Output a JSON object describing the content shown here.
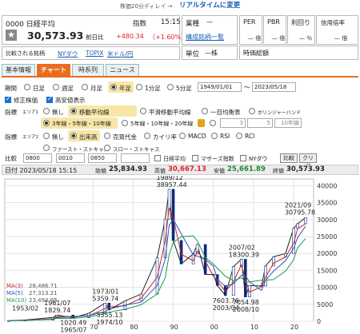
{
  "banner": {
    "notice": "株価20分ディレイ →",
    "realtime": "リアルタイムに変更"
  },
  "quote": {
    "code_name": "0000 日経平均",
    "price": "30,573.93",
    "prev_label": "前日比",
    "change": "+480.34",
    "change_pct": "（+1.60%）",
    "index_label": "指数",
    "time": "15:15"
  },
  "quote2": {
    "industry_label": "業種",
    "industry_value": "—",
    "components_link": "構成銘柄一覧",
    "unit_label": "単位",
    "unit_value": "—株"
  },
  "compare_bar": {
    "label": "比較される銘柄",
    "links": [
      "NYダウ",
      "TOPIX",
      "米ドル/円"
    ]
  },
  "metrics": {
    "headers": [
      "PER",
      "PBR",
      "利回り",
      "信用倍率"
    ],
    "values": [
      "— 倍",
      "— 倍",
      "— ％",
      "— 倍"
    ],
    "market_cap_label": "時価総額"
  },
  "tabs": [
    "基本情報",
    "チャート",
    "時系列",
    "ニュース"
  ],
  "period": {
    "label": "期間",
    "options": [
      "日足",
      "週足",
      "月足",
      "年足",
      "1分足",
      "5分足"
    ],
    "selected": 3,
    "from": "1949/01/01",
    "to": "2023/05/18"
  },
  "flags": {
    "adjusted": "修正株価",
    "high_res": "高安値表示"
  },
  "indicator1": {
    "label": "指標",
    "area": "エリア1",
    "options": [
      "無し",
      "移動平均線",
      "平滑移動平均線",
      "一目均衡表",
      "ボリンジャーバンド"
    ],
    "selected": 1,
    "row2": [
      "3年線・5年線・10年線",
      "5年線・10年線・20年線"
    ],
    "inputs": [
      "3",
      "5",
      "10年線"
    ]
  },
  "indicator2": {
    "label": "指標",
    "area": "エリア2",
    "options": [
      "無し",
      "出来高",
      "売買代金",
      "カイリ率",
      "MACD",
      "RSI",
      "RCI"
    ],
    "selected": 1,
    "row2": [
      "ファースト・ストキャス",
      "スロー・ストキャス"
    ]
  },
  "compare": {
    "label": "比較",
    "codes": [
      "0800",
      "0010",
      "0850"
    ],
    "option_labels": [
      "日経平均",
      "マザーズ指数",
      "NYダウ"
    ],
    "btn_compare": "比較",
    "btn_clear": "クリア"
  },
  "chart_header": {
    "date": "日付 2023/05/18 15:15",
    "open_l": "始値",
    "open": "25,834.93",
    "high_l": "高値",
    "high": "30,667.13",
    "low_l": "安値",
    "low": "25,661.89",
    "close_l": "終値",
    "close": "30,573.93"
  },
  "chart_data": {
    "type": "line",
    "title": "",
    "x": [
      1949,
      1953,
      1960,
      1961,
      1965,
      1969,
      1973,
      1974,
      1978,
      1982,
      1986,
      1988,
      1989,
      1990,
      1992,
      1995,
      1996,
      1998,
      2000,
      2001,
      2003,
      2005,
      2007,
      2008,
      2009,
      2012,
      2013,
      2015,
      2018,
      2020,
      2021,
      2023
    ],
    "series": [
      {
        "name": "price",
        "values": [
          176,
          340,
          1117,
          1829,
          1020,
          2358,
          5359,
          3355,
          6002,
          8017,
          18701,
          30159,
          38957,
          23849,
          16925,
          19868,
          22666,
          13842,
          13785,
          10543,
          7603,
          16111,
          18300,
          7162,
          10546,
          10395,
          16291,
          19034,
          20014,
          27444,
          28791,
          30573
        ]
      }
    ],
    "ma": [
      {
        "name": "MA(3)",
        "value": "28,486.71",
        "color": "#c8242b"
      },
      {
        "name": "MA(5)",
        "value": "27,313.21",
        "color": "#2457c5"
      },
      {
        "name": "MA(10)",
        "value": "23,493.95",
        "color": "#1a9a4a"
      }
    ],
    "yticks": [
      0,
      5000,
      10000,
      15000,
      20000,
      25000,
      30000,
      35000,
      40000
    ],
    "xticks": [
      {
        "v": 1970,
        "l": "70"
      },
      {
        "v": 1980,
        "l": "80"
      },
      {
        "v": 1990,
        "l": "90"
      },
      {
        "v": 2000,
        "l": "00"
      },
      {
        "v": 2010,
        "l": "10"
      },
      {
        "v": 2020,
        "l": "20"
      }
    ],
    "ylim": [
      0,
      42000
    ],
    "xlim": [
      1948,
      2025
    ],
    "annotations": [
      {
        "text": "1953/02",
        "x": 1953,
        "y": 340
      },
      {
        "text": "1961/07",
        "x": 1961,
        "y": 1829
      },
      {
        "text": "1829.74",
        "x": 1961,
        "y": 1829
      },
      {
        "text": "1020.49",
        "x": 1965,
        "y": 1020
      },
      {
        "text": "1965/07",
        "x": 1965,
        "y": 1020
      },
      {
        "text": "1973/01",
        "x": 1973,
        "y": 5359
      },
      {
        "text": "5359.74",
        "x": 1973,
        "y": 5359
      },
      {
        "text": "3355.13",
        "x": 1974,
        "y": 3355
      },
      {
        "text": "1974/10",
        "x": 1974,
        "y": 3355
      },
      {
        "text": "1989/12",
        "x": 1989,
        "y": 38957
      },
      {
        "text": "38957.44",
        "x": 1989,
        "y": 38957
      },
      {
        "text": "2007/02",
        "x": 2007,
        "y": 18300
      },
      {
        "text": "18300.39",
        "x": 2007,
        "y": 18300
      },
      {
        "text": "7603.76",
        "x": 2003,
        "y": 7603
      },
      {
        "text": "2003/04",
        "x": 2003,
        "y": 7603
      },
      {
        "text": "7054.98",
        "x": 2008,
        "y": 7054
      },
      {
        "text": "2008/10",
        "x": 2008,
        "y": 7054
      },
      {
        "text": "2021/09",
        "x": 2021,
        "y": 30795
      },
      {
        "text": "30795.78",
        "x": 2021,
        "y": 30795
      }
    ]
  }
}
